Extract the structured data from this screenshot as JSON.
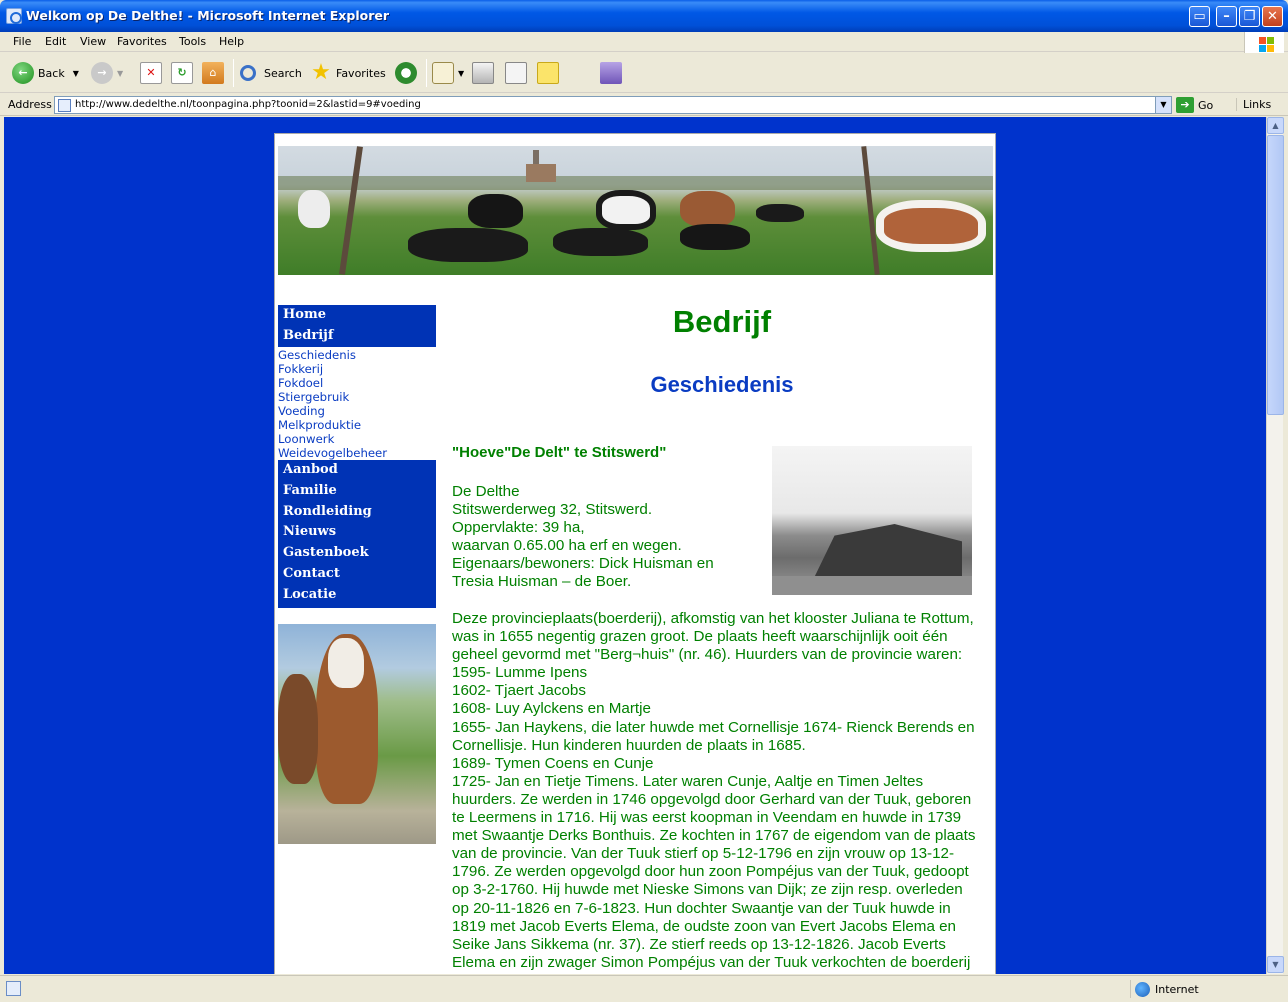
{
  "window": {
    "title": "Welkom op De Delthe! - Microsoft Internet Explorer"
  },
  "menu": [
    "File",
    "Edit",
    "View",
    "Favorites",
    "Tools",
    "Help"
  ],
  "toolbar": {
    "back": "Back",
    "search": "Search",
    "favorites": "Favorites"
  },
  "address": {
    "label": "Address",
    "url": "http://www.dedelthe.nl/toonpagina.php?toonid=2&lastid=9#voeding",
    "go": "Go",
    "links": "Links"
  },
  "nav": {
    "top": [
      "Home",
      "Bedrijf"
    ],
    "sub": [
      "Geschiedenis",
      "Fokkerij",
      "Fokdoel",
      "Stiergebruik",
      "Voeding",
      "Melkproduktie",
      "Loonwerk",
      "Weidevogelbeheer"
    ],
    "bottom": [
      "Aanbod",
      "Familie",
      "Rondleiding",
      "Nieuws",
      "Gastenboek",
      "Contact",
      "Locatie"
    ]
  },
  "content": {
    "heading": "Bedrijf",
    "subheading": "Geschiedenis",
    "farm_title": "\"Hoeve\"De Delt\" te Stitswerd\"",
    "address_lines": [
      "De Delthe",
      "Stitswerderweg 32, Stitswerd.",
      "Oppervlakte: 39 ha,",
      "waarvan 0.65.00 ha erf en wegen.",
      "Eigenaars/bewoners: Dick Huisman en",
      "Tresia Huisman – de Boer."
    ],
    "body_lines": [
      "Deze provincieplaats(boerderij), afkomstig van het klooster Juliana te Rottum,",
      "was in 1655 negentig grazen groot. De plaats heeft waarschijnlijk ooit één",
      "geheel gevormd met \"Berg¬huis\" (nr. 46). Huurders van de provincie waren:",
      "1595- Lumme Ipens",
      "1602- Tjaert Jacobs",
      "1608- Luy Aylckens en Martje",
      "1655- Jan Haykens, die later huwde met Cornellisje 1674- Rienck Berends en",
      "Cornellisje. Hun kinderen huurden de plaats in 1685.",
      "1689- Tymen Coens en Cunje",
      "1725- Jan en Tietje Timens. Later waren Cunje, Aaltje en Timen Jeltes",
      "huurders. Ze werden in 1746 opgevolgd door Gerhard van der Tuuk, geboren",
      "te Leermens in 1716. Hij was eerst koopman in Veendam en huwde in 1739",
      "met Swaantje Derks Bonthuis. Ze kochten in 1767 de eigendom van de plaats",
      "van de provincie. Van der Tuuk stierf op 5-12-1796 en zijn vrouw op 13-12-",
      "1796. Ze werden opgevolgd door hun zoon Pompéjus van der Tuuk, gedoopt",
      "op 3-2-1760. Hij huwde met Nieske Simons van Dijk; ze zijn resp. overleden",
      "op 20-11-1826 en 7-6-1823. Hun dochter Swaantje van der Tuuk huwde in",
      "1819 met Jacob Everts Elema, de oudste zoon van Evert Jacobs Elema en",
      "Seike Jans Sikkema (nr. 37). Ze stierf reeds op 13-12-1826. Jacob Everts",
      "Elema en zijn zwager Simon Pompéjus van der Tuuk verkochten de boerderij"
    ]
  },
  "status": {
    "zone": "Internet"
  },
  "colors": {
    "page_background": "#0033cc",
    "nav_background": "#0033b5",
    "heading_green": "#008000",
    "subheading_blue": "#0a3cc2"
  }
}
